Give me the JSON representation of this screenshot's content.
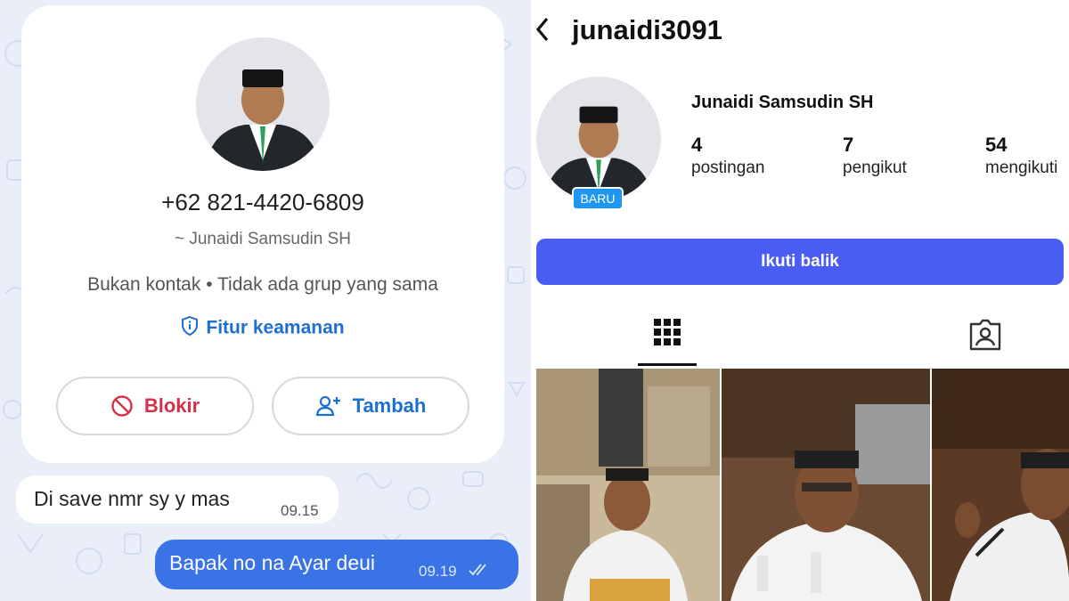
{
  "chat": {
    "contact_phone": "+62 821-4420-6809",
    "contact_pushname": "~ Junaidi Samsudin SH",
    "contact_subinfo": "Bukan kontak • Tidak ada grup yang sama",
    "security_label": "Fitur keamanan",
    "block_label": "Blokir",
    "add_label": "Tambah",
    "messages": [
      {
        "text": "Di save nmr sy y mas",
        "time": "09.15",
        "direction": "incoming"
      },
      {
        "text": "Bapak no na Ayar deui",
        "time": "09.19",
        "direction": "outgoing",
        "status": "read"
      }
    ],
    "colors": {
      "accent": "#1c6fd1",
      "danger": "#d8304a",
      "outgoing_bubble": "#3a73e5",
      "wallpaper": "#e9eef9"
    }
  },
  "profile": {
    "username": "junaidi3091",
    "full_name": "Junaidi Samsudin SH",
    "new_badge": "BARU",
    "stats": [
      {
        "value": "4",
        "label": "postingan"
      },
      {
        "value": "7",
        "label": "pengikut"
      },
      {
        "value": "54",
        "label": "mengikuti"
      }
    ],
    "follow_back_label": "Ikuti balik",
    "tabs": [
      {
        "icon": "grid-icon",
        "active": true
      },
      {
        "icon": "tagged-icon",
        "active": false
      }
    ],
    "colors": {
      "button": "#4a5df2",
      "badge": "#2096f3"
    }
  }
}
